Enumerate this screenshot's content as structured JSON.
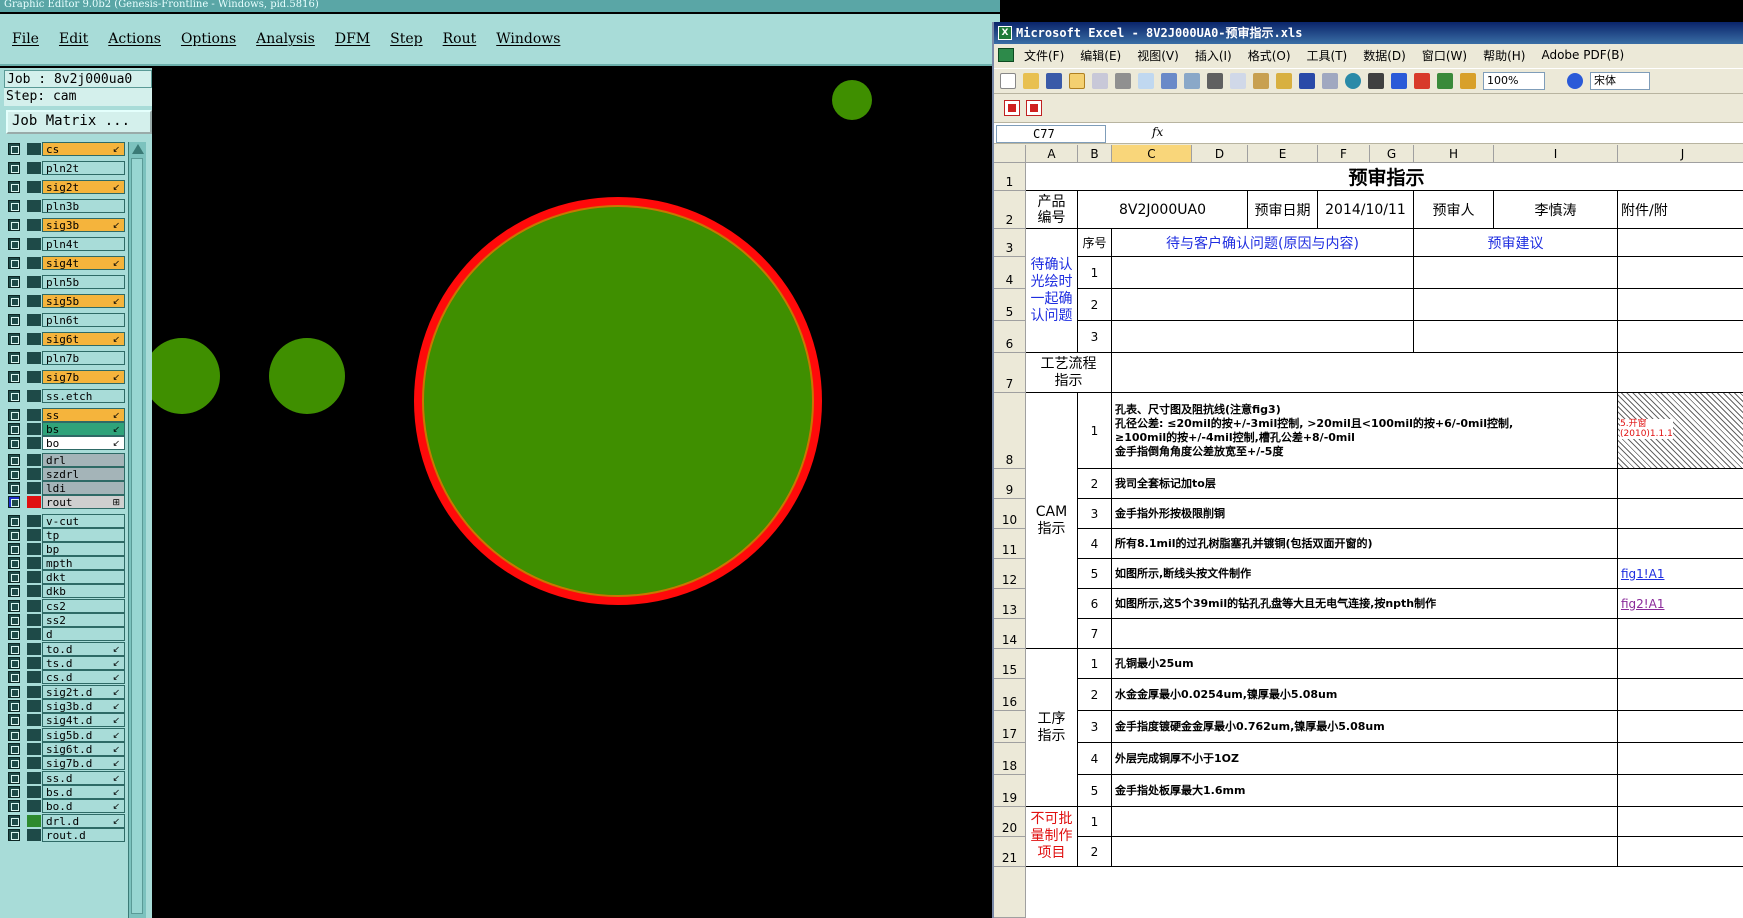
{
  "editor": {
    "title": "Graphic Editor 9.0b2 (Genesis-Frontline - Windows, pid.5816)",
    "menu": [
      "File",
      "Edit",
      "Actions",
      "Options",
      "Analysis",
      "DFM",
      "Step",
      "Rout",
      "Windows"
    ],
    "job_label": "Job : 8v2j000ua0",
    "step_label": "Step: cam",
    "job_matrix_button": "Job Matrix ...",
    "layers": [
      {
        "name": "cs",
        "kind": "signal",
        "tag": "↙"
      },
      {
        "name": "pln2t",
        "kind": "board",
        "tag": ""
      },
      {
        "name": "sig2t",
        "kind": "signal",
        "tag": "↙"
      },
      {
        "name": "pln3b",
        "kind": "board",
        "tag": ""
      },
      {
        "name": "sig3b",
        "kind": "signal",
        "tag": "↙"
      },
      {
        "name": "pln4t",
        "kind": "board",
        "tag": ""
      },
      {
        "name": "sig4t",
        "kind": "signal",
        "tag": "↙"
      },
      {
        "name": "pln5b",
        "kind": "board",
        "tag": ""
      },
      {
        "name": "sig5b",
        "kind": "signal",
        "tag": "↙"
      },
      {
        "name": "pln6t",
        "kind": "board",
        "tag": ""
      },
      {
        "name": "sig6t",
        "kind": "signal",
        "tag": "↙"
      },
      {
        "name": "pln7b",
        "kind": "board",
        "tag": ""
      },
      {
        "name": "sig7b",
        "kind": "signal",
        "tag": "↙"
      },
      {
        "name": "ss.etch",
        "kind": "board",
        "tag": ""
      },
      {
        "name": "ss",
        "kind": "signal",
        "tag": "↙"
      },
      {
        "name": "bs",
        "kind": "green",
        "tag": "↙"
      },
      {
        "name": "bo",
        "kind": "white",
        "tag": "↙"
      },
      {
        "name": "drl",
        "kind": "drill",
        "tag": ""
      },
      {
        "name": "szdrl",
        "kind": "drill",
        "tag": ""
      },
      {
        "name": "ldi",
        "kind": "drill",
        "tag": ""
      },
      {
        "name": "rout",
        "kind": "rout",
        "tag": "⊞",
        "active": true
      },
      {
        "name": "v-cut",
        "kind": "board",
        "tag": ""
      },
      {
        "name": "tp",
        "kind": "board",
        "tag": ""
      },
      {
        "name": "bp",
        "kind": "board",
        "tag": ""
      },
      {
        "name": "mpth",
        "kind": "board",
        "tag": ""
      },
      {
        "name": "dkt",
        "kind": "board",
        "tag": ""
      },
      {
        "name": "dkb",
        "kind": "board",
        "tag": ""
      },
      {
        "name": "cs2",
        "kind": "board",
        "tag": ""
      },
      {
        "name": "ss2",
        "kind": "board",
        "tag": ""
      },
      {
        "name": "d",
        "kind": "board",
        "tag": ""
      },
      {
        "name": "to.d",
        "kind": "board",
        "tag": "↙"
      },
      {
        "name": "ts.d",
        "kind": "board",
        "tag": "↙"
      },
      {
        "name": "cs.d",
        "kind": "board",
        "tag": "↙"
      },
      {
        "name": "sig2t.d",
        "kind": "board",
        "tag": "↙"
      },
      {
        "name": "sig3b.d",
        "kind": "board",
        "tag": "↙"
      },
      {
        "name": "sig4t.d",
        "kind": "board",
        "tag": "↙"
      },
      {
        "name": "sig5b.d",
        "kind": "board",
        "tag": "↙"
      },
      {
        "name": "sig6t.d",
        "kind": "board",
        "tag": "↙"
      },
      {
        "name": "sig7b.d",
        "kind": "board",
        "tag": "↙"
      },
      {
        "name": "ss.d",
        "kind": "board",
        "tag": "↙"
      },
      {
        "name": "bs.d",
        "kind": "board",
        "tag": "↙"
      },
      {
        "name": "bo.d",
        "kind": "board",
        "tag": "↙"
      },
      {
        "name": "drl.d",
        "kind": "board",
        "tag": "↙",
        "swatch": "#2e8a2e"
      },
      {
        "name": "rout.d",
        "kind": "board",
        "tag": ""
      }
    ],
    "colors": {
      "pad_fill": "#3f8f00",
      "rout_outline": "#ff0a0a",
      "background": "#000000"
    }
  },
  "excel": {
    "title": "Microsoft Excel - 8V2J000UA0-预审指示.xls",
    "menu": [
      "文件(F)",
      "编辑(E)",
      "视图(V)",
      "插入(I)",
      "格式(O)",
      "工具(T)",
      "数据(D)",
      "窗口(W)",
      "帮助(H)",
      "Adobe PDF(B)"
    ],
    "zoom": "100%",
    "font": "宋体",
    "name_box": "C77",
    "fx_label": "fx",
    "columns": [
      "A",
      "B",
      "C",
      "D",
      "E",
      "F",
      "G",
      "H",
      "I",
      "J"
    ],
    "selected_column": "C",
    "rows": [
      "1",
      "2",
      "3",
      "4",
      "5",
      "6",
      "7",
      "8",
      "9",
      "10",
      "11",
      "12",
      "13",
      "14",
      "15",
      "16",
      "17",
      "18",
      "19",
      "20",
      "21"
    ],
    "sheet": {
      "title": "预审指示",
      "product_no_label": "产品\n编号",
      "product_no": "8V2J000UA0",
      "review_date_label": "预审日期",
      "review_date": "2014/10/11",
      "reviewer_label": "预审人",
      "reviewer": "李慎涛",
      "attachment_label": "附件/附",
      "seq_label": "序号",
      "issue_header": "待与客户确认问题(原因与内容)",
      "suggestion_header": "预审建议",
      "confirm_group": "待确认光绘时一起确认问题",
      "process_label": "工艺流程\n指示",
      "cam_label": "CAM\n指示",
      "proc_label": "工序\n指示",
      "nobatch_label": "不可批量制作项目",
      "confirm_seq": [
        "1",
        "2",
        "3"
      ],
      "cam_items": [
        {
          "no": "1",
          "text": "孔表、尺寸图及阻抗线(注意fig3)\n孔径公差: ≤20mil的按+/-3mil控制, >20mil且<100mil的按+6/-0mil控制,\n≥100mil的按+/-4mil控制,槽孔公差+8/-0mil\n金手指倒角角度公差放宽至+/-5度"
        },
        {
          "no": "2",
          "text": "我司全套标记加to层"
        },
        {
          "no": "3",
          "text": "金手指外形按极限削铜"
        },
        {
          "no": "4",
          "text": "所有8.1mil的过孔树脂塞孔并镀铜(包括双面开窗的)"
        },
        {
          "no": "5",
          "text": "如图所示,断线头按文件制作",
          "link": "fig1!A1"
        },
        {
          "no": "6",
          "text": "如图所示,这5个39mil的钻孔孔盘等大且无电气连接,按npth制作",
          "link": "fig2!A1"
        },
        {
          "no": "7",
          "text": ""
        }
      ],
      "proc_items": [
        {
          "no": "1",
          "text": "孔铜最小25um"
        },
        {
          "no": "2",
          "text": "水金金厚最小0.0254um,镍厚最小5.08um"
        },
        {
          "no": "3",
          "text": "金手指度镀硬金金厚最小0.762um,镍厚最小5.08um"
        },
        {
          "no": "4",
          "text": "外层完成铜厚不小于1OZ"
        },
        {
          "no": "5",
          "text": "金手指处板厚最大1.6mm"
        }
      ],
      "nobatch_seq": [
        "1",
        "2"
      ],
      "attachment_note": "5.开窗\n(2010)1.1.1"
    }
  }
}
